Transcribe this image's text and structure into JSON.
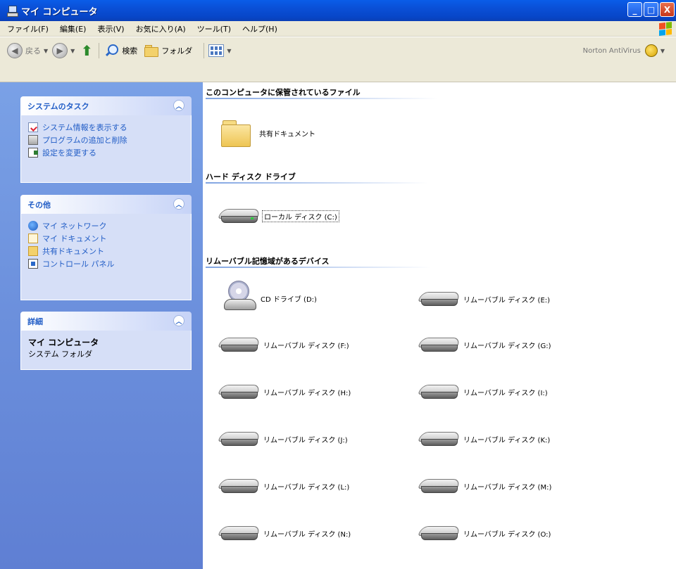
{
  "window": {
    "title": "マイ コンピュータ",
    "buttons": {
      "minimize": "_",
      "maximize": "□",
      "close": "X"
    }
  },
  "menubar": {
    "items": [
      "ファイル(F)",
      "編集(E)",
      "表示(V)",
      "お気に入り(A)",
      "ツール(T)",
      "ヘルプ(H)"
    ]
  },
  "toolbar": {
    "back_label": "戻る",
    "search_label": "検索",
    "folders_label": "フォルダ",
    "norton_label": "Norton AntiVirus"
  },
  "leftpane": {
    "system_tasks": {
      "title": "システムのタスク",
      "links": [
        "システム情報を表示する",
        "プログラムの追加と削除",
        "設定を変更する"
      ]
    },
    "other_places": {
      "title": "その他",
      "links": [
        "マイ ネットワーク",
        "マイ ドキュメント",
        "共有ドキュメント",
        "コントロール パネル"
      ]
    },
    "details": {
      "title": "詳細",
      "name": "マイ コンピュータ",
      "type": "システム フォルダ"
    }
  },
  "content": {
    "groups": [
      {
        "header": "このコンピュータに保管されているファイル",
        "items": [
          "共有ドキュメント"
        ]
      },
      {
        "header": "ハード ディスク ドライブ",
        "items": [
          "ローカル ディスク (C:)"
        ]
      },
      {
        "header": "リムーバブル記憶域があるデバイス",
        "items": [
          "CD ドライブ (D:)",
          "リムーバブル ディスク (E:)",
          "リムーバブル ディスク (F:)",
          "リムーバブル ディスク (G:)",
          "リムーバブル ディスク (H:)",
          "リムーバブル ディスク (I:)",
          "リムーバブル ディスク (J:)",
          "リムーバブル ディスク (K:)",
          "リムーバブル ディスク (L:)",
          "リムーバブル ディスク (M:)",
          "リムーバブル ディスク (N:)",
          "リムーバブル ディスク (O:)"
        ]
      }
    ]
  },
  "colors": {
    "titlebar": "#0a4fd6",
    "menubar": "#ece9d8",
    "leftpane": "#6b8fdc",
    "task_link": "#215dc6",
    "task_body": "#d6dff7"
  },
  "icons": {
    "title": "my-computer-icon",
    "shared_docs": "folder-icon",
    "local_disk": "hard-drive-icon",
    "cd_drive": "cd-drive-icon",
    "removable": "removable-disk-icon"
  }
}
